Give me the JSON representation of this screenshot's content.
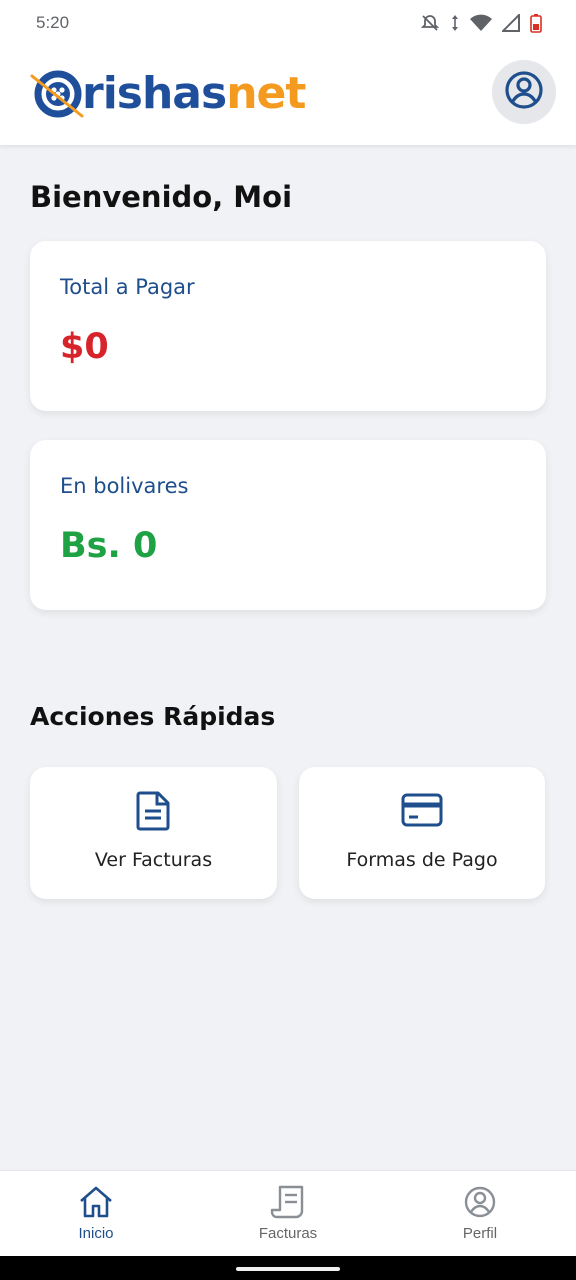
{
  "status_bar": {
    "time": "5:20",
    "icons": [
      "notifications-off-icon",
      "data-arrows-icon",
      "wifi-icon",
      "signal-icon",
      "battery-low-icon"
    ]
  },
  "header": {
    "logo_prefix": "rishas",
    "logo_suffix": "net",
    "profile_icon": "user-circle-icon"
  },
  "greeting": "Bienvenido, Moi",
  "cards": [
    {
      "label": "Total a Pagar",
      "value": "$0",
      "value_color": "#d7232a"
    },
    {
      "label": "En bolivares",
      "value": "Bs. 0",
      "value_color": "#1ea244"
    }
  ],
  "quick_actions": {
    "title": "Acciones Rápidas",
    "items": [
      {
        "label": "Ver Facturas",
        "icon": "document-icon"
      },
      {
        "label": "Formas de Pago",
        "icon": "credit-card-icon"
      }
    ]
  },
  "bottom_nav": {
    "items": [
      {
        "label": "Inicio",
        "icon": "home-icon",
        "active": true
      },
      {
        "label": "Facturas",
        "icon": "receipt-icon",
        "active": false
      },
      {
        "label": "Perfil",
        "icon": "user-circle-icon",
        "active": false
      }
    ]
  },
  "colors": {
    "brand_blue": "#1f4e9b",
    "brand_orange": "#f39a1f",
    "background": "#f1f2f5"
  }
}
